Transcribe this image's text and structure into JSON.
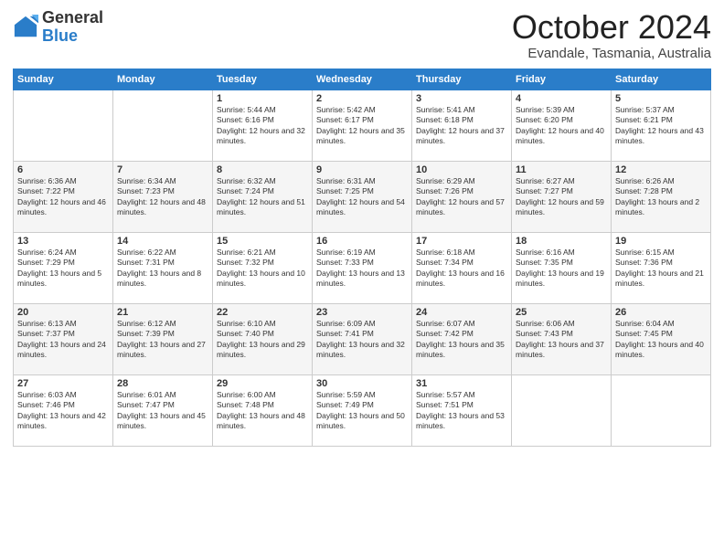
{
  "logo": {
    "general": "General",
    "blue": "Blue"
  },
  "header": {
    "month": "October 2024",
    "location": "Evandale, Tasmania, Australia"
  },
  "days_of_week": [
    "Sunday",
    "Monday",
    "Tuesday",
    "Wednesday",
    "Thursday",
    "Friday",
    "Saturday"
  ],
  "weeks": [
    [
      {
        "day": "",
        "sunrise": "",
        "sunset": "",
        "daylight": ""
      },
      {
        "day": "",
        "sunrise": "",
        "sunset": "",
        "daylight": ""
      },
      {
        "day": "1",
        "sunrise": "Sunrise: 5:44 AM",
        "sunset": "Sunset: 6:16 PM",
        "daylight": "Daylight: 12 hours and 32 minutes."
      },
      {
        "day": "2",
        "sunrise": "Sunrise: 5:42 AM",
        "sunset": "Sunset: 6:17 PM",
        "daylight": "Daylight: 12 hours and 35 minutes."
      },
      {
        "day": "3",
        "sunrise": "Sunrise: 5:41 AM",
        "sunset": "Sunset: 6:18 PM",
        "daylight": "Daylight: 12 hours and 37 minutes."
      },
      {
        "day": "4",
        "sunrise": "Sunrise: 5:39 AM",
        "sunset": "Sunset: 6:20 PM",
        "daylight": "Daylight: 12 hours and 40 minutes."
      },
      {
        "day": "5",
        "sunrise": "Sunrise: 5:37 AM",
        "sunset": "Sunset: 6:21 PM",
        "daylight": "Daylight: 12 hours and 43 minutes."
      }
    ],
    [
      {
        "day": "6",
        "sunrise": "Sunrise: 6:36 AM",
        "sunset": "Sunset: 7:22 PM",
        "daylight": "Daylight: 12 hours and 46 minutes."
      },
      {
        "day": "7",
        "sunrise": "Sunrise: 6:34 AM",
        "sunset": "Sunset: 7:23 PM",
        "daylight": "Daylight: 12 hours and 48 minutes."
      },
      {
        "day": "8",
        "sunrise": "Sunrise: 6:32 AM",
        "sunset": "Sunset: 7:24 PM",
        "daylight": "Daylight: 12 hours and 51 minutes."
      },
      {
        "day": "9",
        "sunrise": "Sunrise: 6:31 AM",
        "sunset": "Sunset: 7:25 PM",
        "daylight": "Daylight: 12 hours and 54 minutes."
      },
      {
        "day": "10",
        "sunrise": "Sunrise: 6:29 AM",
        "sunset": "Sunset: 7:26 PM",
        "daylight": "Daylight: 12 hours and 57 minutes."
      },
      {
        "day": "11",
        "sunrise": "Sunrise: 6:27 AM",
        "sunset": "Sunset: 7:27 PM",
        "daylight": "Daylight: 12 hours and 59 minutes."
      },
      {
        "day": "12",
        "sunrise": "Sunrise: 6:26 AM",
        "sunset": "Sunset: 7:28 PM",
        "daylight": "Daylight: 13 hours and 2 minutes."
      }
    ],
    [
      {
        "day": "13",
        "sunrise": "Sunrise: 6:24 AM",
        "sunset": "Sunset: 7:29 PM",
        "daylight": "Daylight: 13 hours and 5 minutes."
      },
      {
        "day": "14",
        "sunrise": "Sunrise: 6:22 AM",
        "sunset": "Sunset: 7:31 PM",
        "daylight": "Daylight: 13 hours and 8 minutes."
      },
      {
        "day": "15",
        "sunrise": "Sunrise: 6:21 AM",
        "sunset": "Sunset: 7:32 PM",
        "daylight": "Daylight: 13 hours and 10 minutes."
      },
      {
        "day": "16",
        "sunrise": "Sunrise: 6:19 AM",
        "sunset": "Sunset: 7:33 PM",
        "daylight": "Daylight: 13 hours and 13 minutes."
      },
      {
        "day": "17",
        "sunrise": "Sunrise: 6:18 AM",
        "sunset": "Sunset: 7:34 PM",
        "daylight": "Daylight: 13 hours and 16 minutes."
      },
      {
        "day": "18",
        "sunrise": "Sunrise: 6:16 AM",
        "sunset": "Sunset: 7:35 PM",
        "daylight": "Daylight: 13 hours and 19 minutes."
      },
      {
        "day": "19",
        "sunrise": "Sunrise: 6:15 AM",
        "sunset": "Sunset: 7:36 PM",
        "daylight": "Daylight: 13 hours and 21 minutes."
      }
    ],
    [
      {
        "day": "20",
        "sunrise": "Sunrise: 6:13 AM",
        "sunset": "Sunset: 7:37 PM",
        "daylight": "Daylight: 13 hours and 24 minutes."
      },
      {
        "day": "21",
        "sunrise": "Sunrise: 6:12 AM",
        "sunset": "Sunset: 7:39 PM",
        "daylight": "Daylight: 13 hours and 27 minutes."
      },
      {
        "day": "22",
        "sunrise": "Sunrise: 6:10 AM",
        "sunset": "Sunset: 7:40 PM",
        "daylight": "Daylight: 13 hours and 29 minutes."
      },
      {
        "day": "23",
        "sunrise": "Sunrise: 6:09 AM",
        "sunset": "Sunset: 7:41 PM",
        "daylight": "Daylight: 13 hours and 32 minutes."
      },
      {
        "day": "24",
        "sunrise": "Sunrise: 6:07 AM",
        "sunset": "Sunset: 7:42 PM",
        "daylight": "Daylight: 13 hours and 35 minutes."
      },
      {
        "day": "25",
        "sunrise": "Sunrise: 6:06 AM",
        "sunset": "Sunset: 7:43 PM",
        "daylight": "Daylight: 13 hours and 37 minutes."
      },
      {
        "day": "26",
        "sunrise": "Sunrise: 6:04 AM",
        "sunset": "Sunset: 7:45 PM",
        "daylight": "Daylight: 13 hours and 40 minutes."
      }
    ],
    [
      {
        "day": "27",
        "sunrise": "Sunrise: 6:03 AM",
        "sunset": "Sunset: 7:46 PM",
        "daylight": "Daylight: 13 hours and 42 minutes."
      },
      {
        "day": "28",
        "sunrise": "Sunrise: 6:01 AM",
        "sunset": "Sunset: 7:47 PM",
        "daylight": "Daylight: 13 hours and 45 minutes."
      },
      {
        "day": "29",
        "sunrise": "Sunrise: 6:00 AM",
        "sunset": "Sunset: 7:48 PM",
        "daylight": "Daylight: 13 hours and 48 minutes."
      },
      {
        "day": "30",
        "sunrise": "Sunrise: 5:59 AM",
        "sunset": "Sunset: 7:49 PM",
        "daylight": "Daylight: 13 hours and 50 minutes."
      },
      {
        "day": "31",
        "sunrise": "Sunrise: 5:57 AM",
        "sunset": "Sunset: 7:51 PM",
        "daylight": "Daylight: 13 hours and 53 minutes."
      },
      {
        "day": "",
        "sunrise": "",
        "sunset": "",
        "daylight": ""
      },
      {
        "day": "",
        "sunrise": "",
        "sunset": "",
        "daylight": ""
      }
    ]
  ]
}
